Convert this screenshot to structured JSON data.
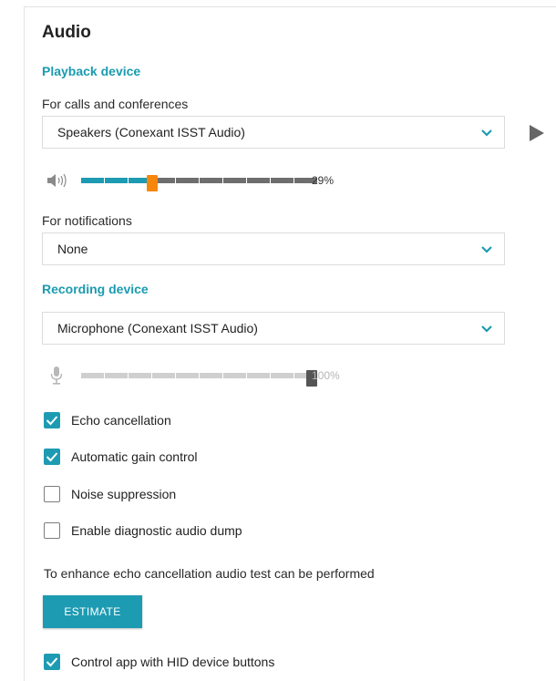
{
  "audio": {
    "title": "Audio",
    "playback": {
      "heading": "Playback device",
      "calls_label": "For calls and conferences",
      "calls_device": "Speakers (Conexant ISST Audio)",
      "speaker_volume_pct": "29%",
      "speaker_volume_value": 0.29,
      "notifications_label": "For notifications",
      "notifications_device": "None"
    },
    "recording": {
      "heading": "Recording device",
      "device": "Microphone (Conexant ISST Audio)",
      "mic_volume_pct": "100%",
      "mic_volume_value": 1.0
    },
    "options": [
      {
        "label": "Echo cancellation",
        "checked": true
      },
      {
        "label": "Automatic gain control",
        "checked": true
      },
      {
        "label": "Noise suppression",
        "checked": false
      },
      {
        "label": "Enable diagnostic audio dump",
        "checked": false
      }
    ],
    "estimate_hint": "To enhance echo cancellation audio test can be performed",
    "estimate_button": "ESTIMATE",
    "hid_option": {
      "label": "Control app with HID device buttons",
      "checked": true
    }
  },
  "colors": {
    "accent": "#1d9bb2",
    "thumb_orange": "#f7860d",
    "track_gray": "#6e6e6e",
    "track_light": "#cfcfcf",
    "thumb_dark": "#555555",
    "muted_text": "#b5b5b5"
  },
  "icons": {
    "play": "play-icon",
    "speaker": "speaker-icon",
    "microphone": "microphone-icon",
    "chevron": "chevron-down-icon",
    "check": "check-icon"
  }
}
